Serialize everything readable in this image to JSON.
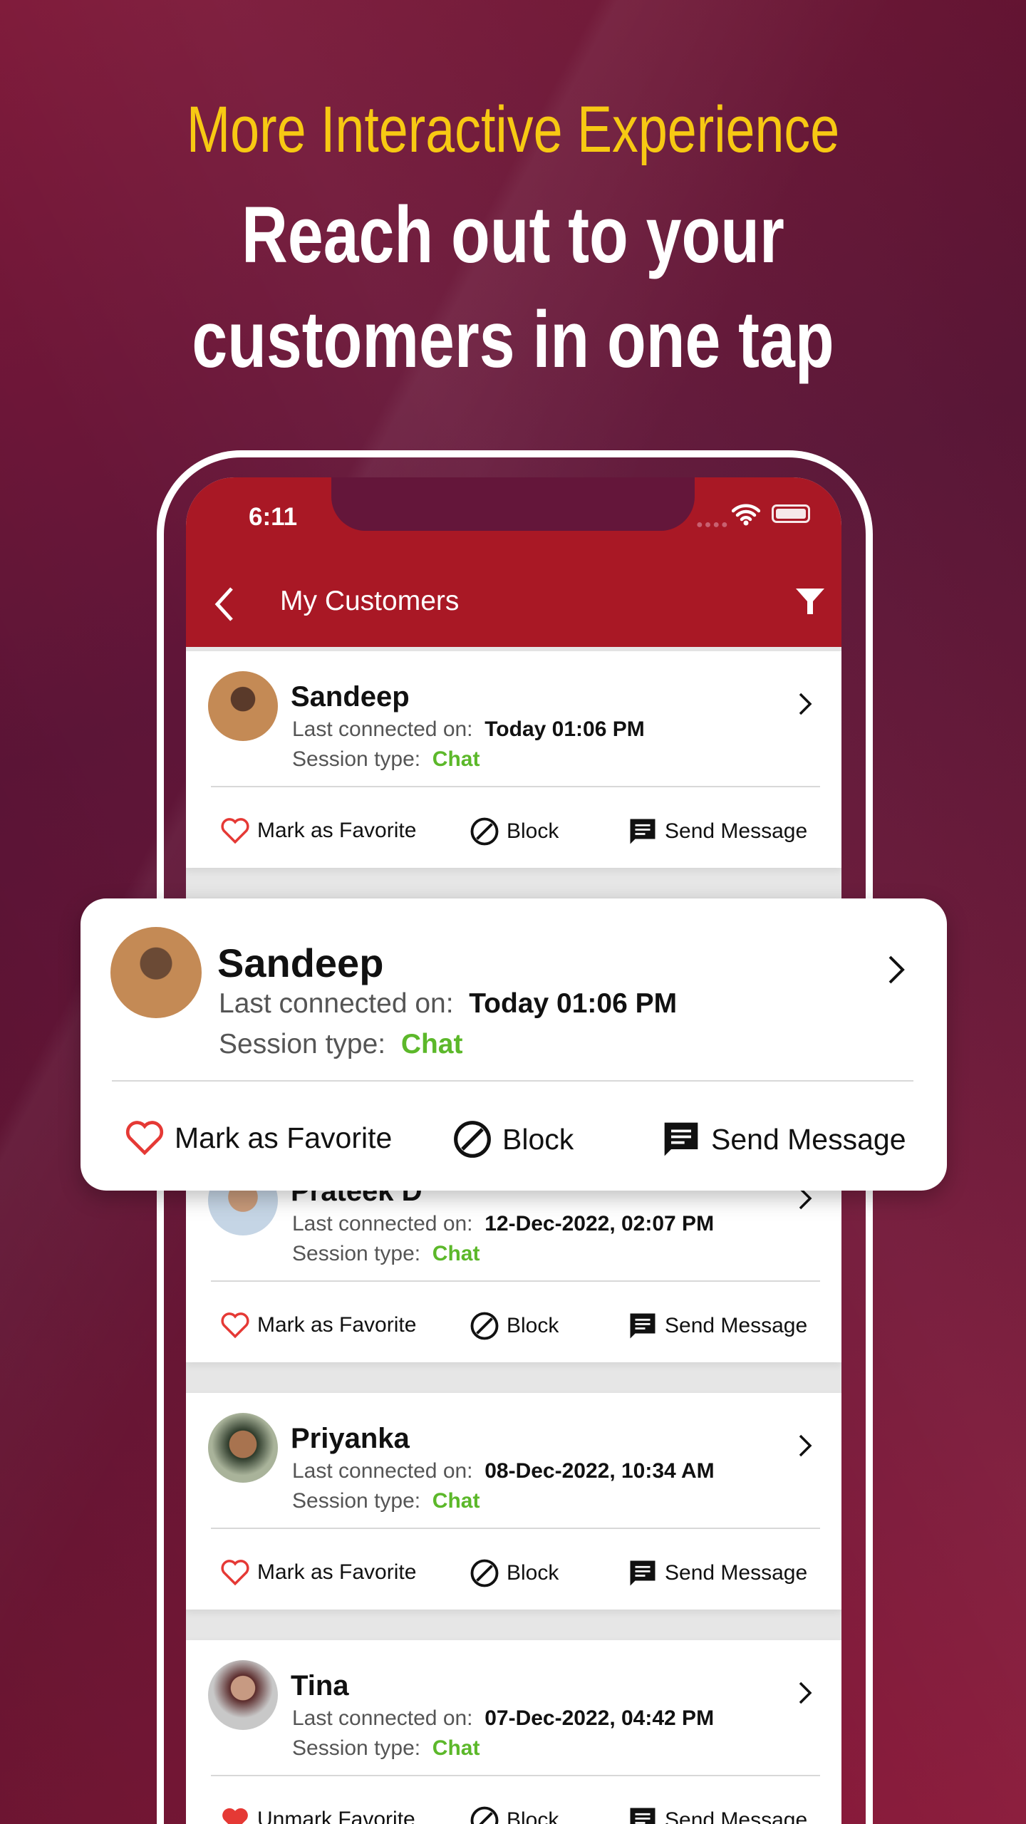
{
  "promo": {
    "tagline": "More Interactive Experience",
    "headline_line1": "Reach out to your",
    "headline_line2": "customers in one tap"
  },
  "status_bar": {
    "time": "6:11"
  },
  "header": {
    "title": "My Customers",
    "back_icon": "chevron-left-icon",
    "filter_icon": "filter-icon"
  },
  "colors": {
    "brand_red": "#a91825",
    "tagline_yellow": "#f7c913",
    "chat_green": "#5cb82a",
    "heart_red": "#e53935"
  },
  "labels": {
    "last_connected": "Last connected on:",
    "session_type": "Session type:",
    "block": "Block",
    "send_message": "Send Message"
  },
  "popup": {
    "name": "Sandeep",
    "last_connected": "Today 01:06 PM",
    "session": "Chat",
    "favorite_label": "Mark as Favorite",
    "favorited": false
  },
  "customers": [
    {
      "name": "Sandeep",
      "last_connected": "Today 01:06 PM",
      "session": "Chat",
      "favorite_label": "Mark as Favorite",
      "favorited": false
    },
    {
      "name": "",
      "last_connected": "",
      "session": "",
      "favorite_label": "",
      "favorited": false
    },
    {
      "name": "Prateek D",
      "last_connected": "12-Dec-2022, 02:07 PM",
      "session": "Chat",
      "favorite_label": "Mark as Favorite",
      "favorited": false
    },
    {
      "name": "Priyanka",
      "last_connected": "08-Dec-2022, 10:34 AM",
      "session": "Chat",
      "favorite_label": "Mark as Favorite",
      "favorited": false
    },
    {
      "name": "Tina",
      "last_connected": "07-Dec-2022, 04:42 PM",
      "session": "Chat",
      "favorite_label": "Unmark Favorite",
      "favorited": true
    }
  ]
}
